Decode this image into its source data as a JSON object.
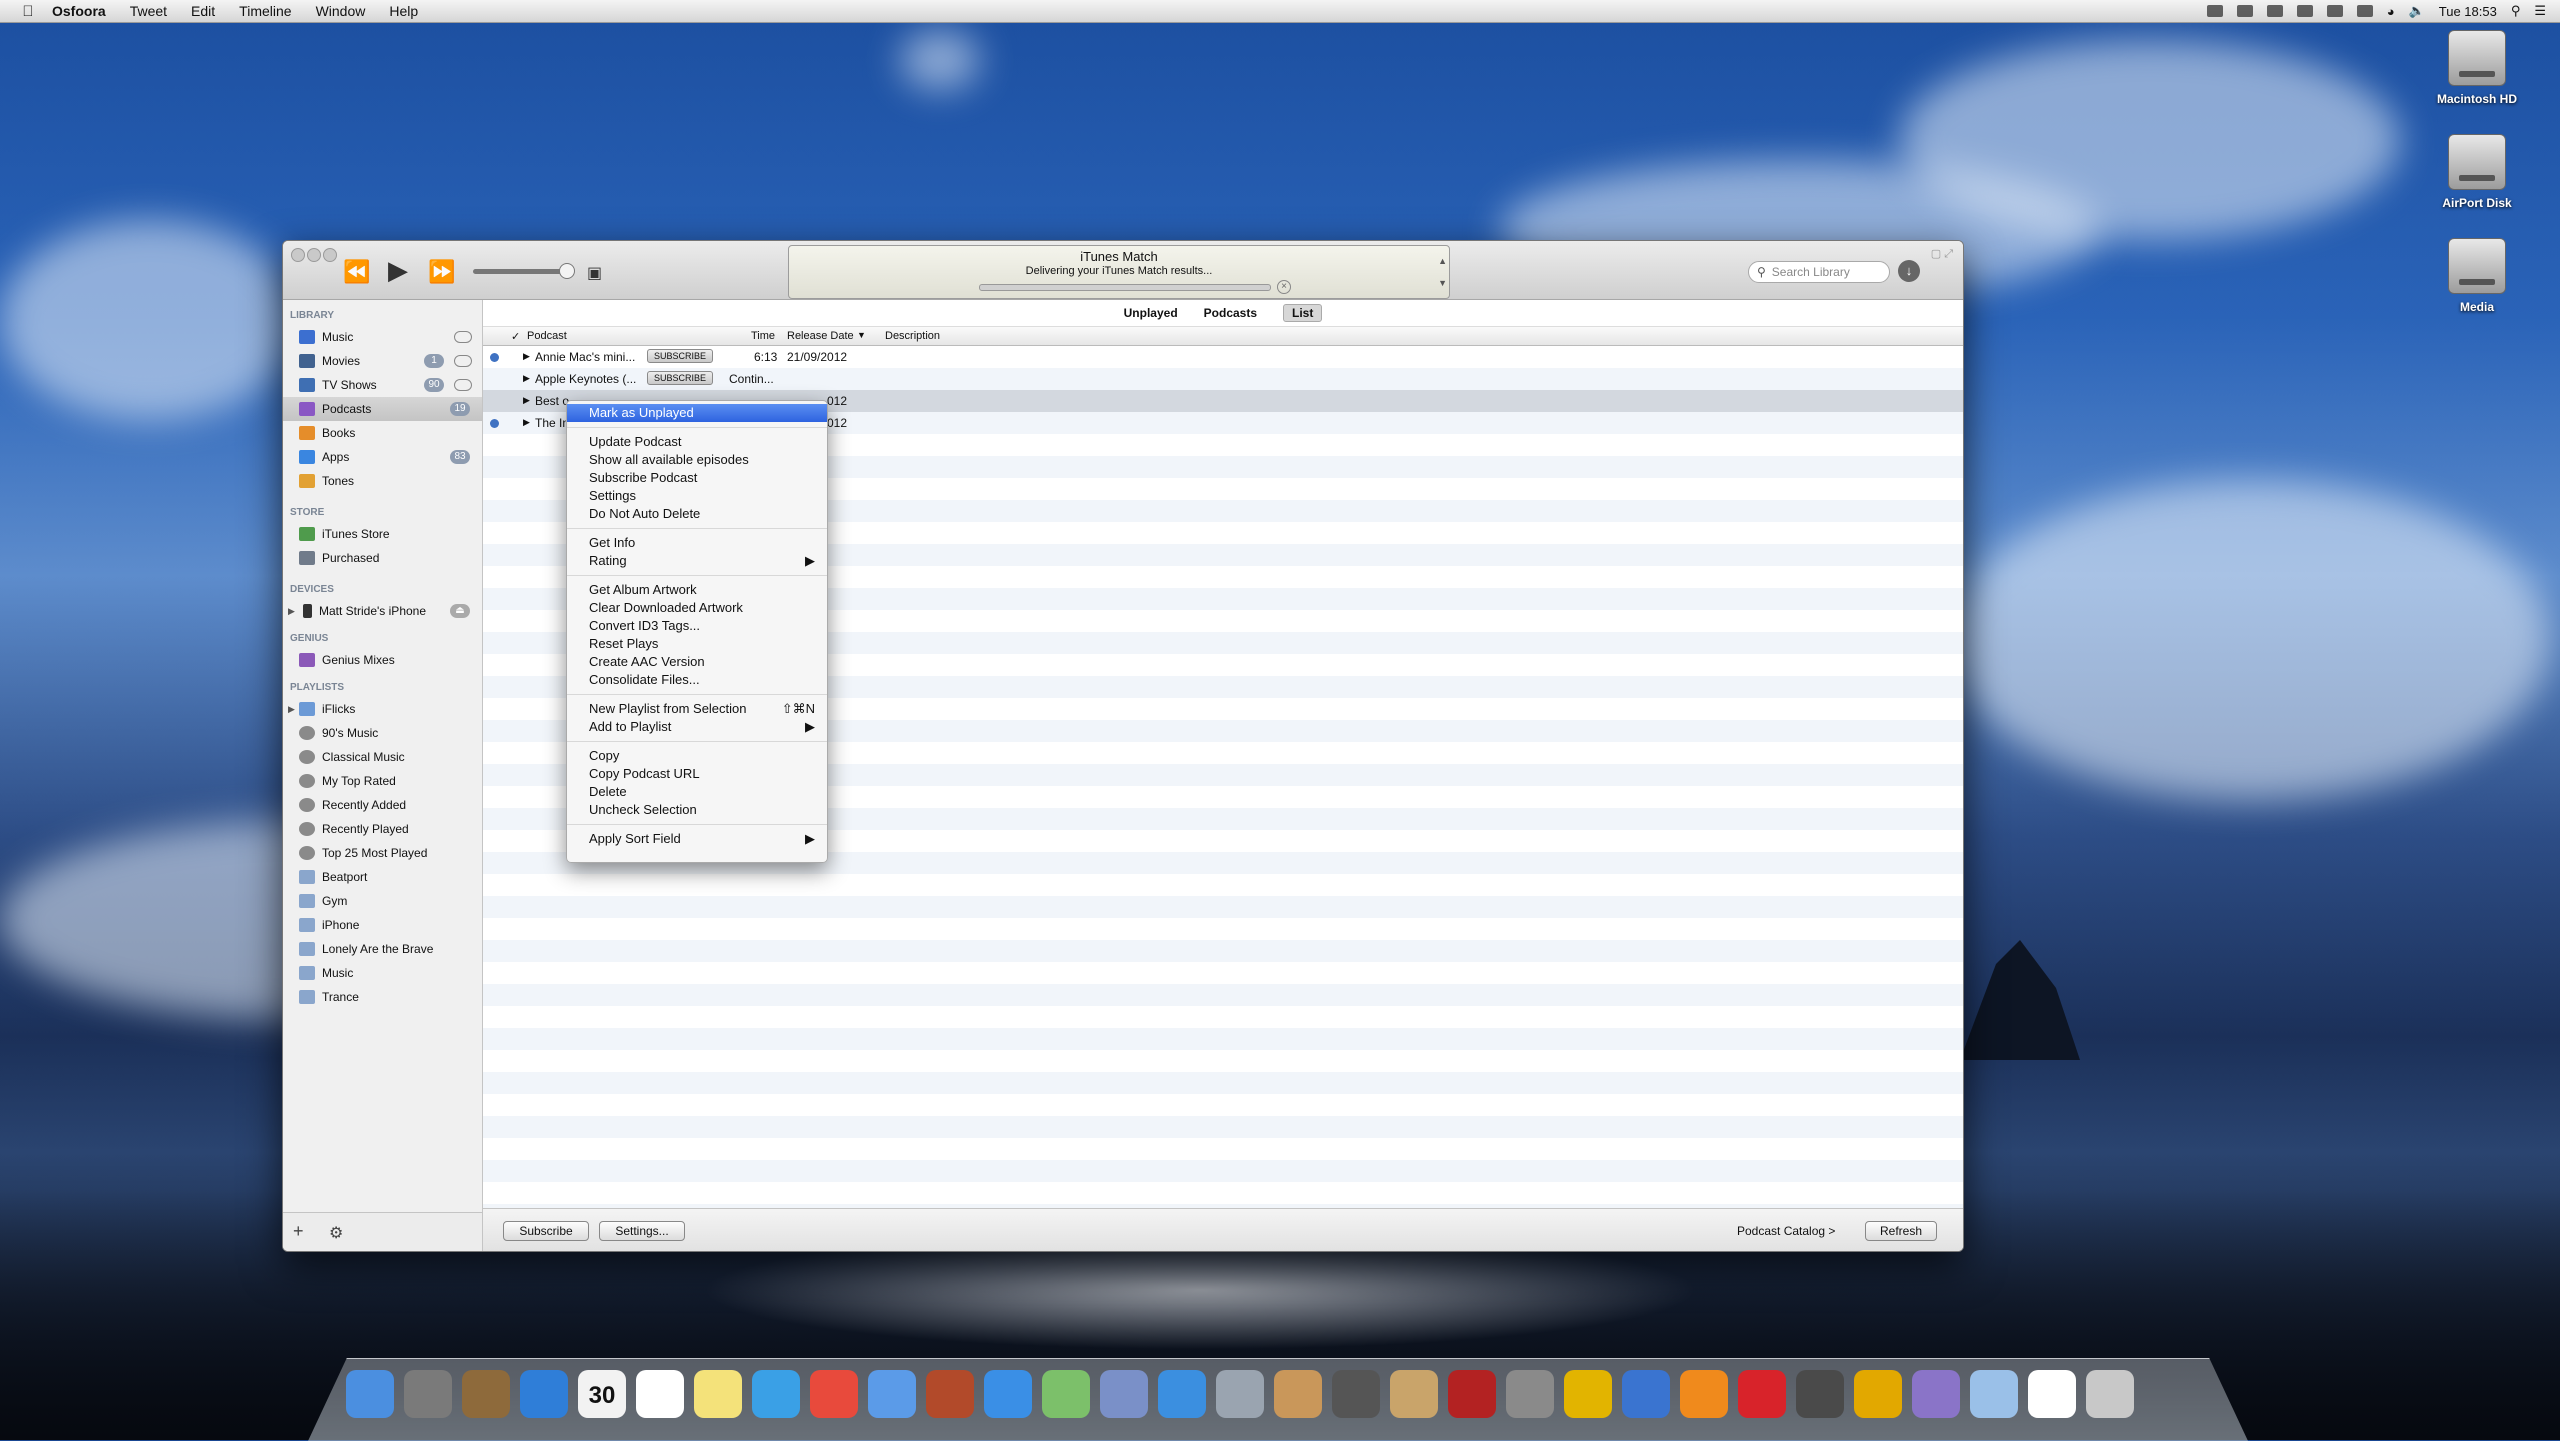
{
  "menubar": {
    "app": "Osfoora",
    "items": [
      "Tweet",
      "Edit",
      "Timeline",
      "Window",
      "Help"
    ],
    "clock": "Tue 18:53"
  },
  "desktop": {
    "icons": [
      "Macintosh HD",
      "AirPort Disk",
      "Media"
    ]
  },
  "itunes": {
    "lcd_title": "iTunes Match",
    "lcd_status": "Delivering your iTunes Match results...",
    "search_placeholder": "Search Library",
    "sidebar": {
      "library_header": "LIBRARY",
      "library": [
        {
          "label": "Music",
          "color": "#3c6fd0"
        },
        {
          "label": "Movies",
          "badge": "1",
          "color": "#41628f"
        },
        {
          "label": "TV Shows",
          "badge": "90",
          "color": "#3f6fb3"
        },
        {
          "label": "Podcasts",
          "badge": "19",
          "color": "#8a57c4"
        },
        {
          "label": "Books",
          "color": "#e58d2a"
        },
        {
          "label": "Apps",
          "badge": "83",
          "color": "#3a86e0"
        },
        {
          "label": "Tones",
          "color": "#e2a133"
        }
      ],
      "store_header": "STORE",
      "store": [
        {
          "label": "iTunes Store",
          "color": "#4f9b4c"
        },
        {
          "label": "Purchased",
          "color": "#707b8a"
        }
      ],
      "devices_header": "DEVICES",
      "devices": [
        {
          "label": "Matt Stride's iPhone",
          "color": "#333"
        }
      ],
      "genius_header": "GENIUS",
      "genius": [
        {
          "label": "Genius Mixes",
          "color": "#8b59b8"
        }
      ],
      "playlists_header": "PLAYLISTS",
      "playlists": [
        {
          "label": "iFlicks",
          "color": "#6c9ad6"
        },
        {
          "label": "90's Music",
          "color": "#8a8a8a"
        },
        {
          "label": "Classical Music",
          "color": "#8a8a8a"
        },
        {
          "label": "My Top Rated",
          "color": "#8a8a8a"
        },
        {
          "label": "Recently Added",
          "color": "#8a8a8a"
        },
        {
          "label": "Recently Played",
          "color": "#8a8a8a"
        },
        {
          "label": "Top 25 Most Played",
          "color": "#8a8a8a"
        },
        {
          "label": "Beatport",
          "color": "#8aa6cc"
        },
        {
          "label": "Gym",
          "color": "#8aa6cc"
        },
        {
          "label": "iPhone",
          "color": "#8aa6cc"
        },
        {
          "label": "Lonely Are the Brave",
          "color": "#8aa6cc"
        },
        {
          "label": "Music",
          "color": "#8aa6cc"
        },
        {
          "label": "Trance",
          "color": "#8aa6cc"
        }
      ]
    },
    "view_tabs": [
      "Unplayed",
      "Podcasts",
      "List"
    ],
    "columns": [
      "Podcast",
      "Time",
      "Release Date",
      "Description"
    ],
    "rows": [
      {
        "podcast": "Annie Mac's mini...",
        "subscribe": "SUBSCRIBE",
        "time": "6:13",
        "date": "21/09/2012",
        "dot": true
      },
      {
        "podcast": "Apple Keynotes (...",
        "subscribe": "SUBSCRIBE",
        "time": "Contin...",
        "date": "",
        "dot": false
      },
      {
        "podcast": "Best o",
        "subscribe": "",
        "time": "",
        "date": "012",
        "dot": false
      },
      {
        "podcast": "The In",
        "subscribe": "",
        "time": "",
        "date": "012",
        "dot": true
      }
    ],
    "bottom": {
      "subscribe": "Subscribe",
      "settings": "Settings...",
      "catalog": "Podcast Catalog >",
      "refresh": "Refresh"
    }
  },
  "context_menu": {
    "groups": [
      [
        {
          "label": "Mark as Unplayed",
          "highlight": true
        }
      ],
      [
        {
          "label": "Update Podcast"
        },
        {
          "label": "Show all available episodes"
        },
        {
          "label": "Subscribe Podcast"
        },
        {
          "label": "Settings"
        },
        {
          "label": "Do Not Auto Delete"
        }
      ],
      [
        {
          "label": "Get Info"
        },
        {
          "label": "Rating",
          "submenu": true
        }
      ],
      [
        {
          "label": "Get Album Artwork"
        },
        {
          "label": "Clear Downloaded Artwork"
        },
        {
          "label": "Convert ID3 Tags..."
        },
        {
          "label": "Reset Plays"
        },
        {
          "label": "Create AAC Version"
        },
        {
          "label": "Consolidate Files..."
        }
      ],
      [
        {
          "label": "New Playlist from Selection",
          "shortcut": "⇧⌘N"
        },
        {
          "label": "Add to Playlist",
          "submenu": true
        }
      ],
      [
        {
          "label": "Copy"
        },
        {
          "label": "Copy Podcast URL"
        },
        {
          "label": "Delete"
        },
        {
          "label": "Uncheck Selection"
        }
      ],
      [
        {
          "label": "Apply Sort Field",
          "submenu": true
        }
      ]
    ]
  },
  "dock": {
    "calendar_day": "30",
    "items": [
      "finder-icon",
      "launchpad-icon",
      "dashboard-icon",
      "app-store-icon",
      "calendar-icon",
      "reminders-icon",
      "notes-icon",
      "safari-icon",
      "chrome-icon",
      "itunes-icon",
      "birdhouse-icon",
      "messages-icon",
      "maps-icon",
      "preview-icon",
      "twitter-icon",
      "mail-icon",
      "photos-icon",
      "camera-icon",
      "contacts-icon",
      "photo-booth-icon",
      "system-prefs-icon",
      "cocktail-icon",
      "screen-icon",
      "vlc-icon",
      "parallels-icon",
      "steam-icon",
      "hairdryer-icon",
      "files-icon",
      "folder-icon",
      "document-icon",
      "trash-icon"
    ]
  }
}
